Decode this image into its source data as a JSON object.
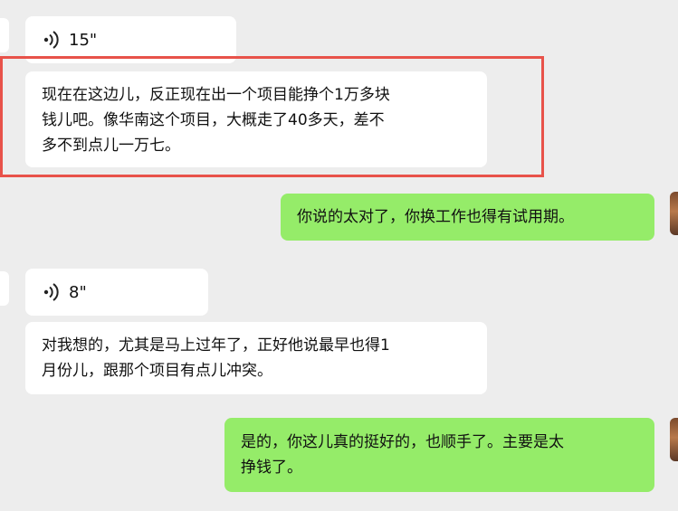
{
  "messages": [
    {
      "type": "voice",
      "side": "left",
      "duration": "15\""
    },
    {
      "type": "text",
      "side": "left",
      "highlighted": true,
      "text": "现在在这边儿，反正现在出一个项目能挣个1万多块\n钱儿吧。像华南这个项目，大概走了40多天，差不\n多不到点儿一万七。"
    },
    {
      "type": "text",
      "side": "right",
      "text": "你说的太对了，你换工作也得有试用期。"
    },
    {
      "type": "voice",
      "side": "left",
      "duration": "8\""
    },
    {
      "type": "text",
      "side": "left",
      "text": "对我想的，尤其是马上过年了，正好他说最早也得1\n月份儿，跟那个项目有点儿冲突。"
    },
    {
      "type": "text",
      "side": "right",
      "text": "是的，你这儿真的挺好的，也顺手了。主要是太\n挣钱了。"
    }
  ],
  "colors": {
    "background": "#ededed",
    "incoming_bubble": "#ffffff",
    "outgoing_bubble": "#95ec69",
    "highlight_border": "#e8524a"
  },
  "icons": {
    "voice": "voice-wave-icon"
  }
}
